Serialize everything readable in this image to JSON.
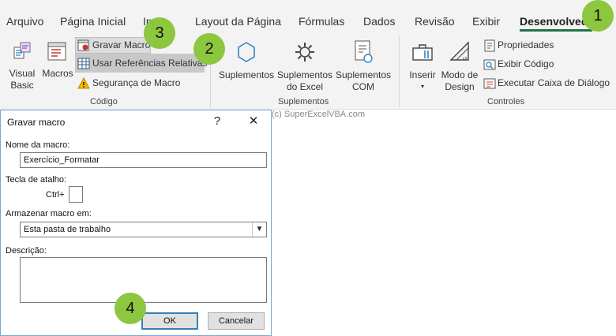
{
  "tabs": [
    "Arquivo",
    "Página Inicial",
    "Inserir",
    "Layout da Página",
    "Fórmulas",
    "Dados",
    "Revisão",
    "Exibir",
    "Desenvolvedor"
  ],
  "tabs_visible": [
    "Arquivo",
    "Página Inicial",
    "In",
    "Layout da Página",
    "Fórmulas",
    "Dados",
    "Revisão",
    "Exibir",
    "Desenvolvedo"
  ],
  "ribbon": {
    "codigo": {
      "label": "Código",
      "visual_basic": "Visual\nBasic",
      "visual_basic_l1": "Visual",
      "visual_basic_l2": "Basic",
      "macros": "Macros",
      "gravar_macro": "Gravar Macro",
      "usar_referencias": "Usar Referências Relativas",
      "seguranca": "Segurança de Macro"
    },
    "suplementos": {
      "label": "Suplementos",
      "suplementos": "Suplementos",
      "excel_l1": "Suplementos",
      "excel_l2": "do Excel",
      "com_l1": "Suplementos",
      "com_l2": "COM"
    },
    "controles": {
      "label": "Controles",
      "inserir": "Inserir",
      "modo_l1": "Modo de",
      "modo_l2": "Design",
      "propriedades": "Propriedades",
      "exibir_codigo": "Exibir Código",
      "executar": "Executar Caixa de Diálogo"
    }
  },
  "badges": [
    "1",
    "2",
    "3",
    "4"
  ],
  "watermark": "(c) SuperExcelVBA.com",
  "dialog": {
    "title": "Gravar macro",
    "help": "?",
    "close": "✕",
    "nome_label": "Nome da macro:",
    "nome_value": "Exercício_Formatar",
    "tecla_label": "Tecla de atalho:",
    "ctrl": "Ctrl+",
    "tecla_value": "",
    "armazenar_label": "Armazenar macro em:",
    "armazenar_value": "Esta pasta de trabalho",
    "descricao_label": "Descrição:",
    "descricao_value": "",
    "ok": "OK",
    "cancelar": "Cancelar"
  },
  "colors": {
    "accent": "#217346",
    "badge": "#8dc63f",
    "dialog_border": "#7aa7d8"
  }
}
